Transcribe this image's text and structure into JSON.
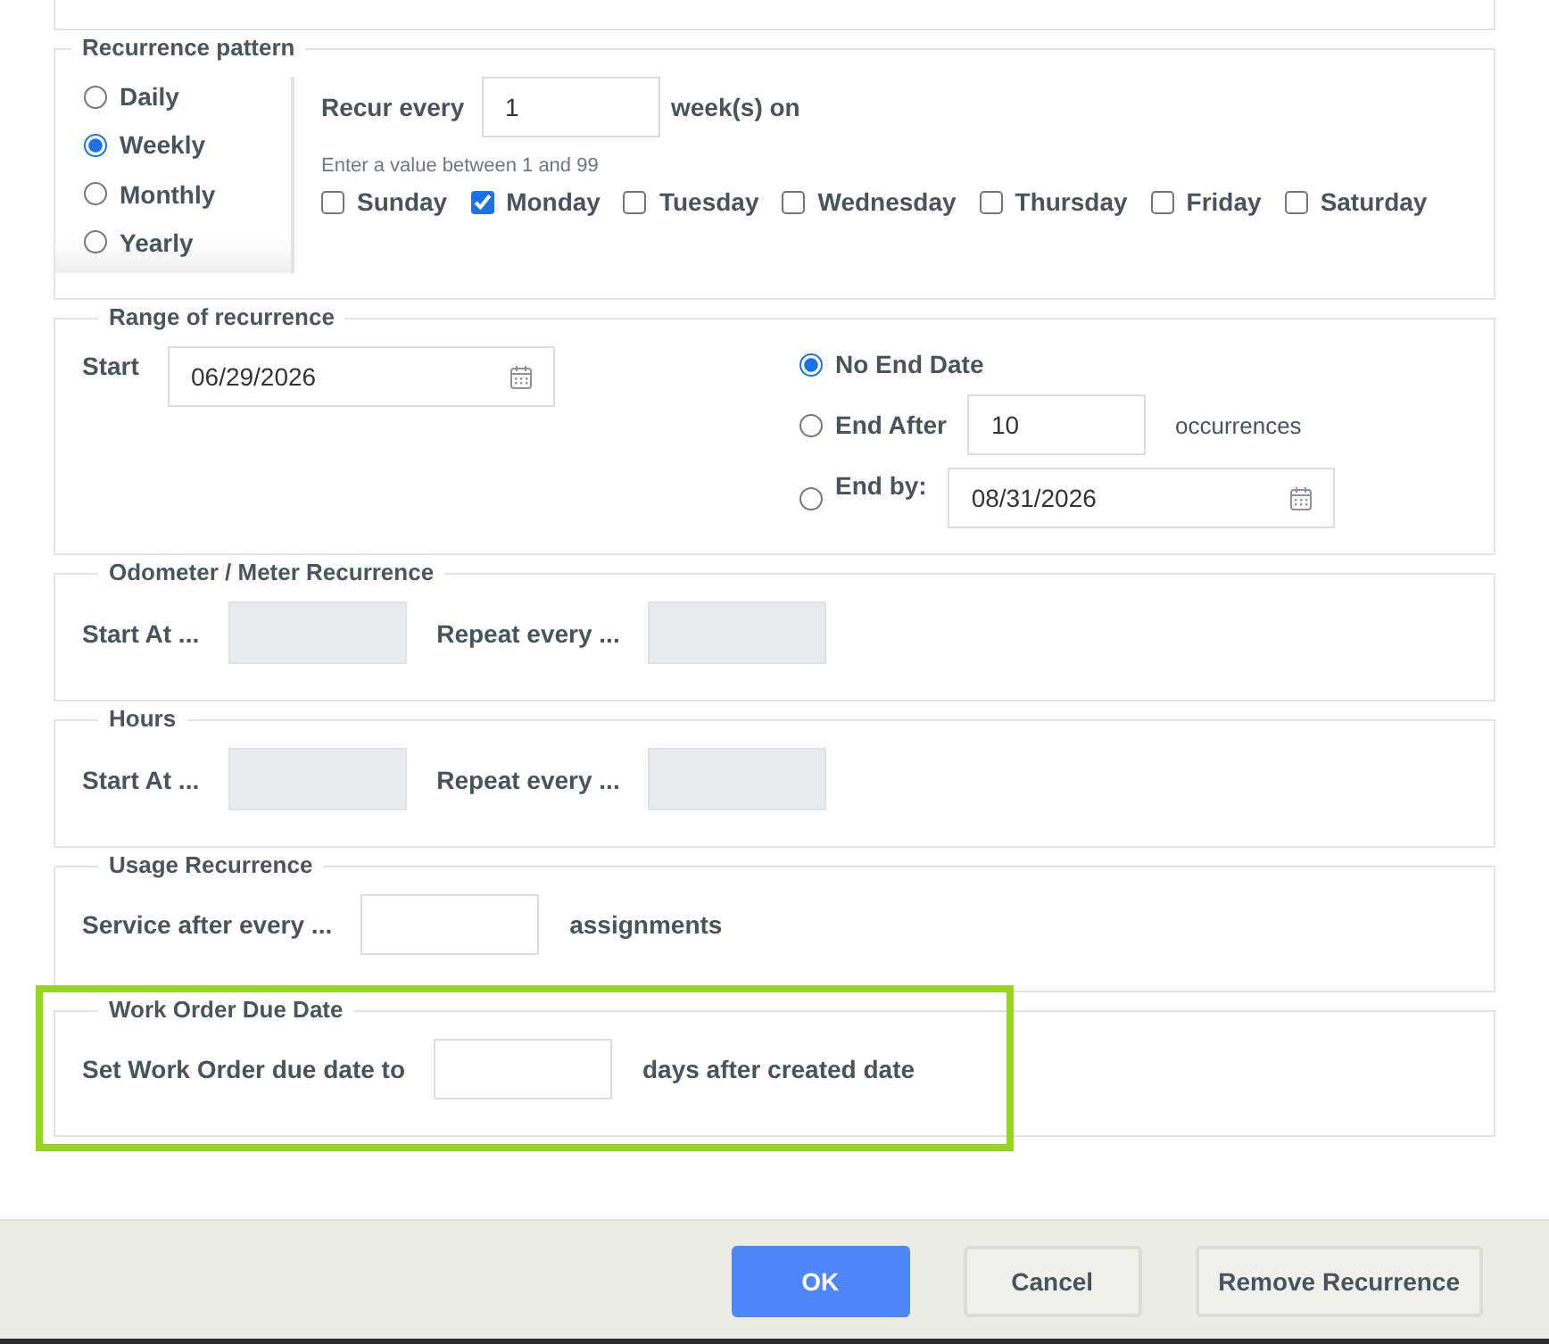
{
  "sections": [
    {
      "kind": "pattern",
      "legend": "Recurrence pattern",
      "highlighted": false,
      "frequencies": [
        {
          "label": "Daily",
          "selected": false
        },
        {
          "label": "Weekly",
          "selected": true
        },
        {
          "label": "Monthly",
          "selected": false
        },
        {
          "label": "Yearly",
          "selected": false
        }
      ],
      "recur_every": {
        "label": "Recur every",
        "value": "1",
        "unit": "week(s) on",
        "hint": "Enter a value between 1 and 99"
      },
      "days": [
        {
          "label": "Sunday",
          "checked": false
        },
        {
          "label": "Monday",
          "checked": true
        },
        {
          "label": "Tuesday",
          "checked": false
        },
        {
          "label": "Wednesday",
          "checked": false
        },
        {
          "label": "Thursday",
          "checked": false
        },
        {
          "label": "Friday",
          "checked": false
        },
        {
          "label": "Saturday",
          "checked": false
        }
      ]
    },
    {
      "kind": "range",
      "legend": "Range of recurrence",
      "highlighted": false,
      "start": {
        "label": "Start",
        "value": "06/29/2026"
      },
      "end_options": [
        {
          "kind": "none",
          "label": "No End Date",
          "selected": true
        },
        {
          "kind": "count",
          "label": "End After",
          "value": "10",
          "unit": "occurrences",
          "selected": false
        },
        {
          "kind": "date",
          "label": "End by:",
          "value": "08/31/2026",
          "selected": false
        }
      ]
    },
    {
      "kind": "fields",
      "legend": "Odometer / Meter Recurrence",
      "highlighted": false,
      "fields": [
        {
          "label": "Start At ...",
          "disabled": true
        },
        {
          "label": "Repeat every ...",
          "disabled": true
        }
      ]
    },
    {
      "kind": "fields",
      "legend": "Hours",
      "highlighted": false,
      "fields": [
        {
          "label": "Start At ...",
          "disabled": true
        },
        {
          "label": "Repeat every ...",
          "disabled": true
        }
      ]
    },
    {
      "kind": "fields",
      "legend": "Usage Recurrence",
      "highlighted": false,
      "fields": [
        {
          "label": "Service after every ...",
          "disabled": false,
          "unit": "assignments"
        }
      ]
    },
    {
      "kind": "fields",
      "legend": "Work Order Due Date",
      "highlighted": true,
      "fields": [
        {
          "label": "Set Work Order due date to",
          "disabled": false,
          "unit": "days after created date"
        }
      ]
    }
  ],
  "buttons": [
    {
      "kind": "primary",
      "label": "OK"
    },
    {
      "kind": "secondary",
      "label": "Cancel"
    },
    {
      "kind": "secondary",
      "label": "Remove Recurrence"
    }
  ]
}
